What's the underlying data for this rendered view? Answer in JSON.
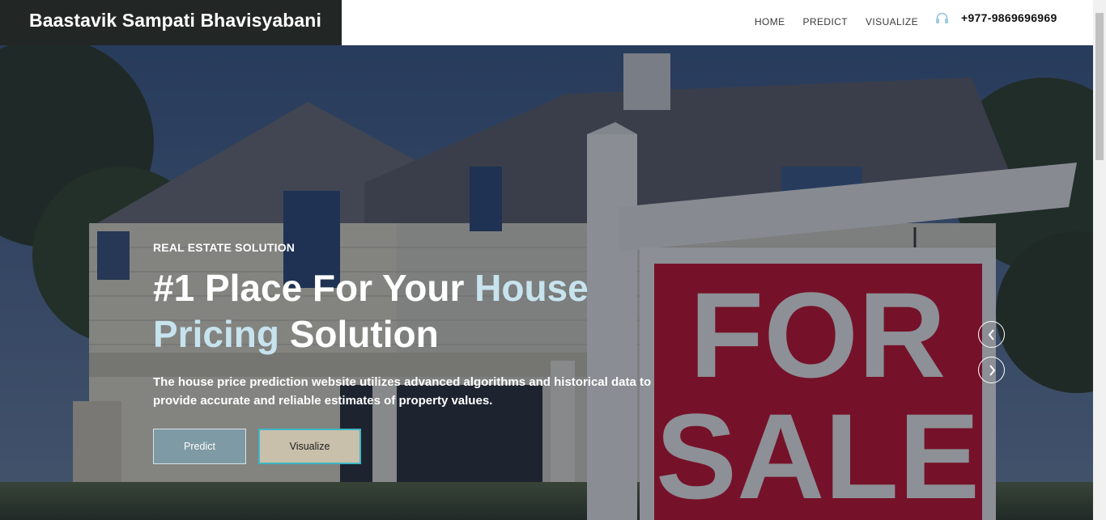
{
  "brand": {
    "name": "Baastavik Sampati Bhavisyabani"
  },
  "nav": {
    "items": [
      {
        "label": "HOME"
      },
      {
        "label": "PREDICT"
      },
      {
        "label": "VISUALIZE"
      }
    ],
    "phone": "+977-9869696969",
    "phone_icon": "headphones-icon"
  },
  "hero": {
    "eyebrow": "REAL ESTATE SOLUTION",
    "headline": {
      "part1": "#1 Place For Your ",
      "accent1": "House",
      "accent2": "Pricing",
      "part2": " Solution"
    },
    "description": "The house price prediction website utilizes advanced algorithms and historical data to provide accurate and reliable estimates of property values.",
    "sign": {
      "line1": "FOR",
      "line2": "SALE"
    },
    "buttons": {
      "predict": "Predict",
      "visualize": "Visualize"
    },
    "carousel": {
      "prev_icon": "chevron-left-icon",
      "next_icon": "chevron-right-icon"
    }
  },
  "colors": {
    "brand_bg": "#222725",
    "accent_text": "#c6e3ee",
    "predict_bg": "#7e9aa4",
    "visualize_bg": "#c9c0ab",
    "visualize_border": "#3fb7c4",
    "sign_red": "#c8102e"
  }
}
